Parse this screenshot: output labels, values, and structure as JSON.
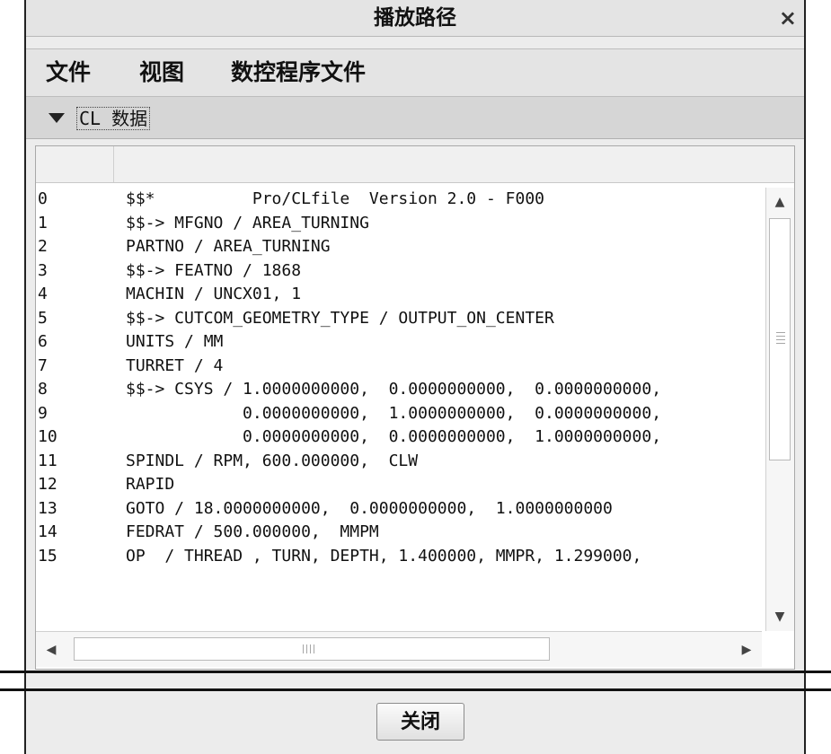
{
  "dialog": {
    "title": "播放路径",
    "close_icon": "×"
  },
  "menu": {
    "items": [
      "文件",
      "视图",
      "数控程序文件"
    ]
  },
  "section": {
    "label": "CL 数据",
    "expanded": true
  },
  "rows": [
    {
      "n": "0",
      "text": "$$*          Pro/CLfile  Version 2.0 - F000"
    },
    {
      "n": "1",
      "text": "$$-> MFGNO / AREA_TURNING"
    },
    {
      "n": "2",
      "text": "PARTNO / AREA_TURNING"
    },
    {
      "n": "3",
      "text": "$$-> FEATNO / 1868"
    },
    {
      "n": "4",
      "text": "MACHIN / UNCX01, 1"
    },
    {
      "n": "5",
      "text": "$$-> CUTCOM_GEOMETRY_TYPE / OUTPUT_ON_CENTER"
    },
    {
      "n": "6",
      "text": "UNITS / MM"
    },
    {
      "n": "7",
      "text": "TURRET / 4"
    },
    {
      "n": "8",
      "text": "$$-> CSYS / 1.0000000000,  0.0000000000,  0.0000000000,"
    },
    {
      "n": "9",
      "text": "            0.0000000000,  1.0000000000,  0.0000000000,"
    },
    {
      "n": "10",
      "text": "            0.0000000000,  0.0000000000,  1.0000000000,"
    },
    {
      "n": "11",
      "text": "SPINDL / RPM, 600.000000,  CLW"
    },
    {
      "n": "12",
      "text": "RAPID"
    },
    {
      "n": "13",
      "text": "GOTO / 18.0000000000,  0.0000000000,  1.0000000000"
    },
    {
      "n": "14",
      "text": "FEDRAT / 500.000000,  MMPM"
    },
    {
      "n": "15",
      "text": "OP  / THREAD , TURN, DEPTH, 1.400000, MMPR, 1.299000,"
    }
  ],
  "footer": {
    "close_label": "关闭"
  },
  "icons": {
    "expand": "triangle-down-icon",
    "scroll_up": "▲",
    "scroll_down": "▼",
    "scroll_left": "◀",
    "scroll_right": "▶"
  }
}
